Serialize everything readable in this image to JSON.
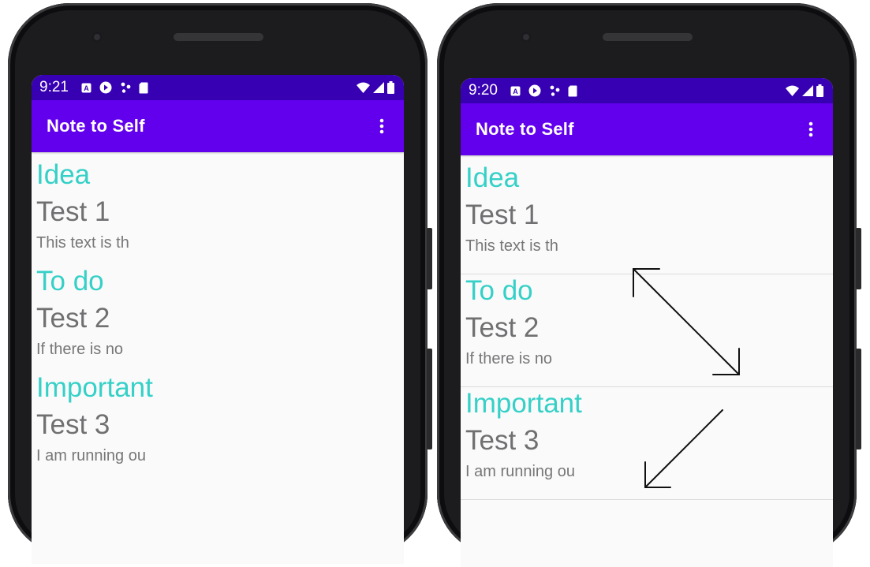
{
  "phones": [
    {
      "status": {
        "time": "9:21"
      },
      "app_title": "Note to Self",
      "notes": [
        {
          "type": "Idea",
          "title": "Test 1",
          "desc": "This text is th"
        },
        {
          "type": "To do",
          "title": "Test 2",
          "desc": "If there is no"
        },
        {
          "type": "Important",
          "title": "Test 3",
          "desc": "I am running ou"
        }
      ]
    },
    {
      "status": {
        "time": "9:20"
      },
      "app_title": "Note to Self",
      "notes": [
        {
          "type": "Idea",
          "title": "Test 1",
          "desc": "This text is th"
        },
        {
          "type": "To do",
          "title": "Test 2",
          "desc": "If there is no"
        },
        {
          "type": "Important",
          "title": "Test 3",
          "desc": "I am running ou"
        }
      ]
    }
  ],
  "status_icons": [
    "a-notification-icon",
    "play-store-icon",
    "share-dots-icon",
    "sd-card-icon",
    "wifi-icon",
    "signal-icon",
    "battery-icon"
  ],
  "colors": {
    "status_bar": "#3700b3",
    "app_bar": "#6200ee",
    "note_type": "#35d0c7",
    "note_text": "#707072"
  }
}
